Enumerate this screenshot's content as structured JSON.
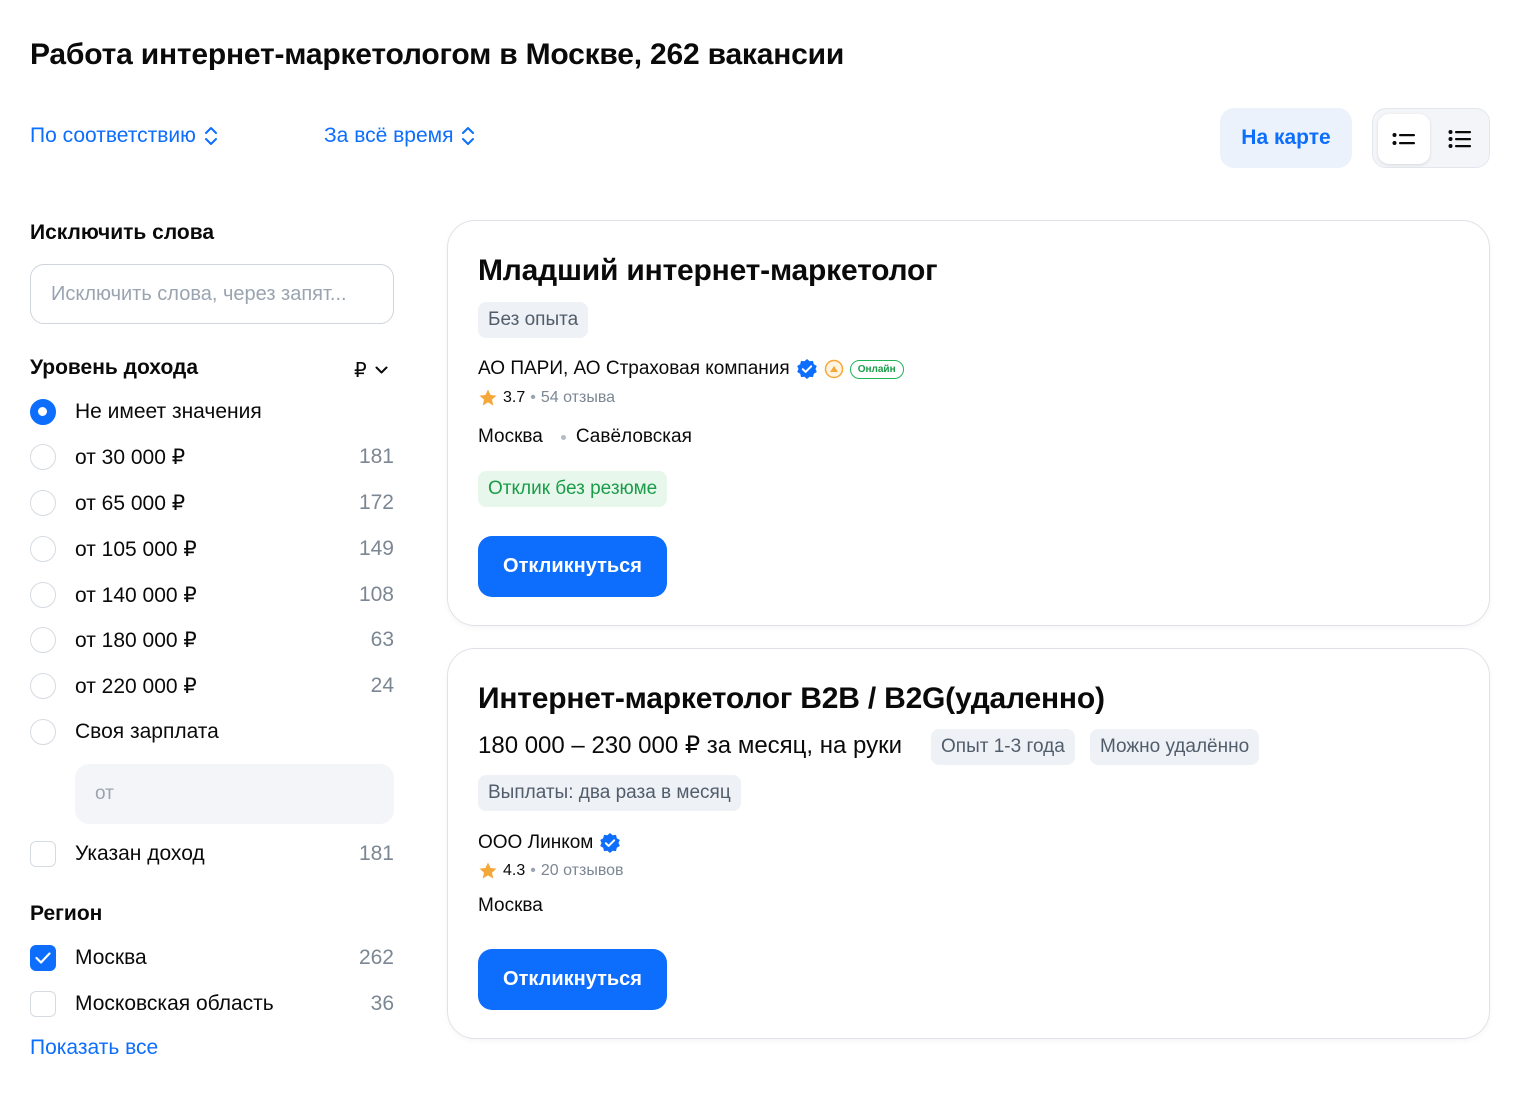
{
  "page_title": "Работа интернет-маркетологом в Москве, 262 вакансии",
  "sort": {
    "relevance_label": "По соответствию",
    "period_label": "За всё время"
  },
  "map_button_label": "На карте",
  "sidebar": {
    "exclude_title": "Исключить слова",
    "exclude_placeholder": "Исключить слова, через запят...",
    "income_title": "Уровень дохода",
    "currency": "₽",
    "income_options": [
      {
        "label": "Не имеет значения",
        "count": "",
        "checked": true
      },
      {
        "label": "от 30 000 ₽",
        "count": "181"
      },
      {
        "label": "от 65 000 ₽",
        "count": "172"
      },
      {
        "label": "от 105 000 ₽",
        "count": "149"
      },
      {
        "label": "от 140 000 ₽",
        "count": "108"
      },
      {
        "label": "от 180 000 ₽",
        "count": "63"
      },
      {
        "label": "от 220 000 ₽",
        "count": "24"
      },
      {
        "label": "Своя зарплата",
        "count": ""
      }
    ],
    "salary_placeholder": "от",
    "income_specified": {
      "label": "Указан доход",
      "count": "181"
    },
    "region_title": "Регион",
    "regions": [
      {
        "label": "Москва",
        "count": "262",
        "checked": true
      },
      {
        "label": "Московская область",
        "count": "36",
        "checked": false
      }
    ],
    "show_all_label": "Показать все"
  },
  "vacancies": [
    {
      "title": "Младший интернет-маркетолог",
      "experience_chip": "Без опыта",
      "company": "АО ПАРИ, АО Страховая компания",
      "online_badge": "Онлайн",
      "rating": "3.7",
      "reviews": "54 отзыва",
      "city": "Москва",
      "metro": "Савёловская",
      "no_resume_chip": "Отклик без резюме",
      "respond_label": "Откликнуться"
    },
    {
      "title": "Интернет-маркетолог B2B / B2G(удаленно)",
      "salary": "180 000 – 230 000 ₽ за месяц, на руки",
      "experience_chip": "Опыт 1-3 года",
      "remote_chip": "Можно удалённо",
      "payout_chip": "Выплаты: два раза в месяц",
      "company": "ООО Линком",
      "rating": "4.3",
      "reviews": "20 отзывов",
      "city": "Москва",
      "respond_label": "Откликнуться"
    }
  ],
  "colors": {
    "accent": "#0d6efd",
    "success": "#1a9c49",
    "chip_bg": "#eef1f5",
    "star": "#f5a83a"
  }
}
